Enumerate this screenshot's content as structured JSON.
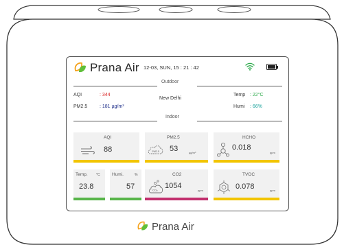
{
  "header": {
    "brand": "Prana Air",
    "datetime": "12-03, SUN, 15 : 21 : 42",
    "wifi_icon": "wifi-icon",
    "battery_icon": "battery-icon",
    "wifi_color": "#2ba94a"
  },
  "outdoor": {
    "title": "Outdoor",
    "location": "New Delhi",
    "aqi_label": "AQI",
    "aqi_value": ": 344",
    "pm25_label": "PM2.5",
    "pm25_value": ": 181 µg/m³",
    "temp_label": "Temp",
    "temp_value": ": 22°C",
    "humi_label": "Humi",
    "humi_value": ": 66%"
  },
  "indoor": {
    "title": "Indoor",
    "cards": {
      "aqi": {
        "label": "AQI",
        "value": "88",
        "icon": "wind-icon",
        "bar_color": "#f2c500"
      },
      "pm25": {
        "label": "PM2.5",
        "value": "53",
        "unit": "µg/m³",
        "icon": "pm25-cloud-icon",
        "icon_text": "PM2.5",
        "bar_color": "#f2c500"
      },
      "hcho": {
        "label": "HCHO",
        "value": "0.018",
        "unit": "ppm",
        "icon": "molecule-icon",
        "bar_color": "#f2c500"
      },
      "temp": {
        "label": "Temp.",
        "unit_symbol": "°C",
        "value": "23.8",
        "bar_color": "#58b54a"
      },
      "humi": {
        "label": "Humi.",
        "unit_symbol": "%",
        "value": "57",
        "bar_color": "#58b54a"
      },
      "co2": {
        "label": "CO2",
        "value": "1054",
        "unit": "ppm",
        "icon": "co2-cloud-icon",
        "icon_text": "CO₂",
        "bar_color": "#c2306e"
      },
      "tvoc": {
        "label": "TVOC",
        "value": "0.078",
        "unit": "ppm",
        "icon": "benzene-icon",
        "bar_color": "#f2c500"
      }
    }
  },
  "footer": {
    "brand": "Prana Air"
  },
  "colors": {
    "leaf_orange": "#f5a21b",
    "leaf_green": "#5fbf3a"
  }
}
